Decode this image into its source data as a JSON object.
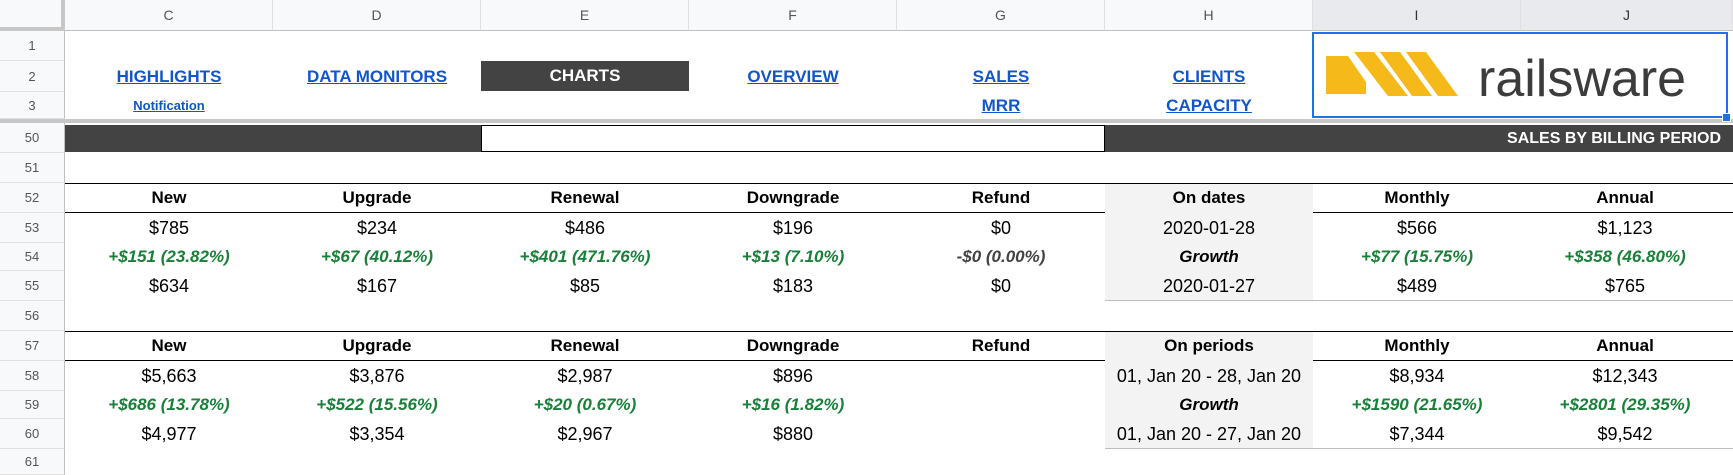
{
  "columns": [
    "C",
    "D",
    "E",
    "F",
    "G",
    "H",
    "I",
    "J"
  ],
  "rows": [
    "1",
    "2",
    "3",
    "50",
    "51",
    "52",
    "53",
    "54",
    "55",
    "56",
    "57",
    "58",
    "59",
    "60",
    "61"
  ],
  "nav": {
    "highlights": "HIGHLIGHTS",
    "notification": "Notification",
    "data_monitors": "DATA MONITORS",
    "charts": "CHARTS",
    "overview": "OVERVIEW",
    "sales": "SALES",
    "mrr": "MRR",
    "clients": "CLIENTS",
    "capacity": "CAPACITY"
  },
  "logo": {
    "text": "railsware",
    "accent": "#f6b91a",
    "text_color": "#3c3c3c"
  },
  "section_title": "SALES BY BILLING PERIOD",
  "dates_block": {
    "headers": [
      "New",
      "Upgrade",
      "Renewal",
      "Downgrade",
      "Refund",
      "On dates",
      "Monthly",
      "Annual"
    ],
    "current": [
      "$785",
      "$234",
      "$486",
      "$196",
      "$0",
      "2020-01-28",
      "$566",
      "$1,123"
    ],
    "growth": [
      "+$151 (23.82%)",
      "+$67 (40.12%)",
      "+$401 (471.76%)",
      "+$13 (7.10%)",
      "-$0 (0.00%)",
      "Growth",
      "+$77 (15.75%)",
      "+$358 (46.80%)"
    ],
    "previous": [
      "$634",
      "$167",
      "$85",
      "$183",
      "$0",
      "2020-01-27",
      "$489",
      "$765"
    ]
  },
  "periods_block": {
    "headers": [
      "New",
      "Upgrade",
      "Renewal",
      "Downgrade",
      "Refund",
      "On periods",
      "Monthly",
      "Annual"
    ],
    "current": [
      "$5,663",
      "$3,876",
      "$2,987",
      "$896",
      "",
      "01, Jan 20 - 28, Jan 20",
      "$8,934",
      "$12,343"
    ],
    "growth": [
      "+$686 (13.78%)",
      "+$522 (15.56%)",
      "+$20 (0.67%)",
      "+$16 (1.82%)",
      "",
      "Growth",
      "+$1590 (21.65%)",
      "+$2801 (29.35%)"
    ],
    "previous": [
      "$4,977",
      "$3,354",
      "$2,967",
      "$880",
      "",
      "01, Jan 20 - 27, Jan 20",
      "$7,344",
      "$9,542"
    ]
  },
  "colors": {
    "link": "#1155cc",
    "dark": "#434343",
    "growth": "#188038",
    "shade": "#f3f3f3",
    "selection": "#1a73e8"
  }
}
